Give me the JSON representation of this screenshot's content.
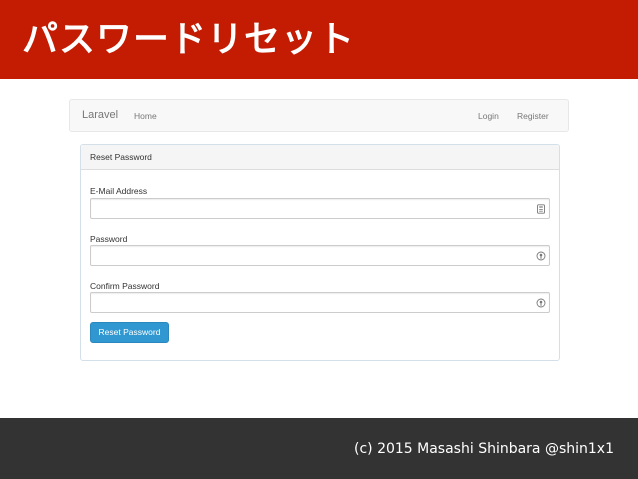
{
  "slide": {
    "title": "パスワードリセット",
    "footer": "(c) 2015 Masashi Shinbara @shin1x1"
  },
  "navbar": {
    "brand": "Laravel",
    "home": "Home",
    "login": "Login",
    "register": "Register"
  },
  "panel": {
    "heading": "Reset Password",
    "email_label": "E-Mail Address",
    "email_value": "",
    "password_label": "Password",
    "password_value": "",
    "confirm_label": "Confirm Password",
    "confirm_value": "",
    "submit_label": "Reset Password"
  },
  "colors": {
    "header_red": "#c31c02",
    "footer_dark": "#333333",
    "button_blue": "#3097d1"
  },
  "icons": {
    "email_field": "contact-card-icon",
    "password_field": "key-icon",
    "confirm_field": "key-icon"
  }
}
